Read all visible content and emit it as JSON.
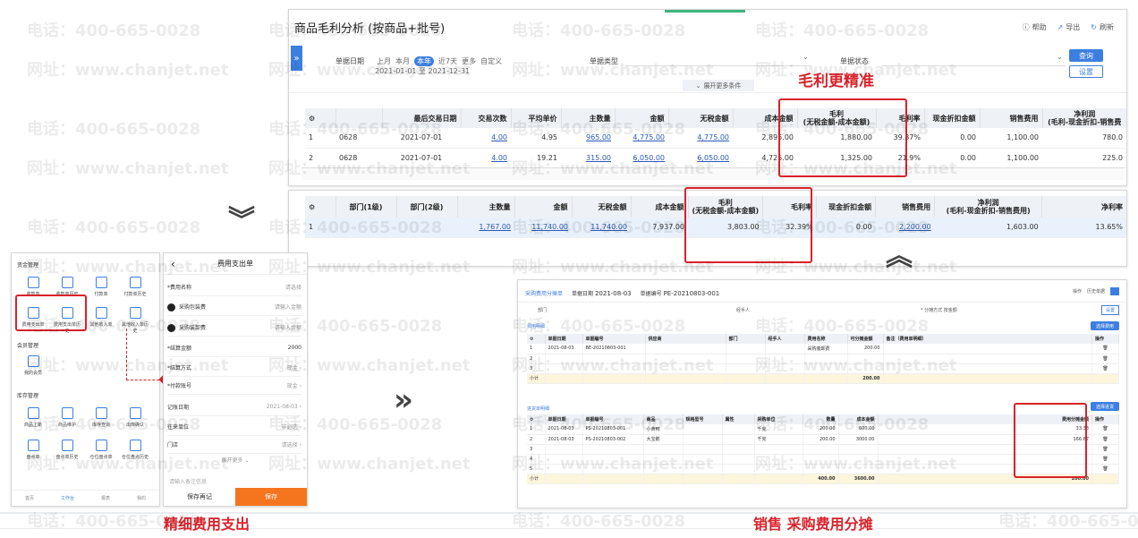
{
  "watermark": {
    "phone": "电话：400-665-0028",
    "site": "网址：www.chanjet.net"
  },
  "report": {
    "title": "商品毛利分析 (按商品+批号)",
    "help": "帮助",
    "export": "导出",
    "refresh": "刷新",
    "filter_date_label": "单据日期",
    "date_options": [
      "上月",
      "本月",
      "本年",
      "近7天",
      "更多",
      "自定义"
    ],
    "date_selected": "本年",
    "date_range_from": "2021-01-01",
    "date_range_to_word": "至",
    "date_range_to": "2021-12-31",
    "doc_type_label": "单据类型",
    "doc_status_label": "单据状态",
    "query_button": "查询",
    "settings_button": "设置",
    "expand_label": "展开更多条件",
    "table1": {
      "headers": [
        "最后交易日期",
        "交易次数",
        "平均单价",
        "主数量",
        "金额",
        "无税金额",
        "成本金额",
        "毛利",
        "毛利率",
        "现金折扣金额",
        "销售费用",
        "净利润"
      ],
      "profit_sub": "(无税金额-成本金额)",
      "net_sub": "(毛利-现金折扣-销售费",
      "rows": [
        [
          "1",
          "0628",
          "2021-07-01",
          "4.00",
          "4.95",
          "965.00",
          "4,775.00",
          "4,775.00",
          "2,895.00",
          "1,880.00",
          "39.37%",
          "0.00",
          "1,100.00",
          "780.0"
        ],
        [
          "2",
          "0628",
          "2021-07-01",
          "4.00",
          "19.21",
          "315.00",
          "6,050.00",
          "6,050.00",
          "4,725.00",
          "1,325.00",
          "21.9%",
          "0.00",
          "1,100.00",
          "225.0"
        ]
      ]
    },
    "table2": {
      "headers": [
        "部门(1级)",
        "部门(2级)",
        "主数量",
        "金额",
        "无税金额",
        "成本金额",
        "毛利",
        "毛利率",
        "现金折扣金额",
        "销售费用",
        "净利润",
        "净利率"
      ],
      "profit_sub": "(无税金额-成本金额)",
      "net_sub": "(毛利-现金折扣-销售费用)",
      "rows": [
        [
          "1",
          "",
          "",
          "1,767.00",
          "11,740.00",
          "11,740.00",
          "7,937.00",
          "3,803.00",
          "32.39%",
          "0.00",
          "2,200.00",
          "1,603.00",
          "13.65%"
        ]
      ]
    }
  },
  "captions": {
    "profit": "毛利更精准",
    "expense": "精细费用支出",
    "allocation": "销售 采购费用分摊"
  },
  "mobile_menu": {
    "section1": "资金管理",
    "items1": [
      "收款单",
      "收款单历史",
      "付款单",
      "付款单历史",
      "费用支出单",
      "费用支出单历史",
      "其他收入单",
      "其他收入单历史"
    ],
    "section2": "会员管理",
    "items2": [
      "我的会员"
    ],
    "section3": "库存管理",
    "items3": [
      "商品上新",
      "商品维护",
      "库存查询",
      "出库确认",
      "盘点单",
      "盘点单历史",
      "仓位盘点单",
      "仓位盘点历史"
    ],
    "bottom_nav": [
      "首页",
      "工作台",
      "报表",
      "我的"
    ]
  },
  "mobile_form": {
    "title": "费用支出单",
    "fields": [
      {
        "label": "*费用名称",
        "value": "请选择"
      },
      {
        "label": "采购包装费",
        "value": "请输入金额"
      },
      {
        "label": "采购装卸费",
        "value": "请输入金额"
      },
      {
        "label": "*结算金额",
        "value": "2000"
      },
      {
        "label": "*结算方式",
        "value": "现金"
      },
      {
        "label": "*付款账号",
        "value": "现金"
      },
      {
        "label": "记账日期",
        "value": "2021-08-03"
      },
      {
        "label": "往来单位",
        "value": "非必选"
      },
      {
        "label": "门店",
        "value": "请选择"
      }
    ],
    "more": "展开更多",
    "note_placeholder": "请输入备注信息",
    "save_again": "保存再记",
    "save": "保存"
  },
  "alloc": {
    "tab": "采购费用分摊单",
    "date_label": "单据日期",
    "date": "2021-08-03",
    "no_label": "单据编号",
    "no": "PE-20210803-001",
    "dept_label": "部门",
    "handler_label": "经手人",
    "method_label": "* 分摊方式",
    "method": "按金额",
    "ops": [
      "操作",
      "历史单据"
    ],
    "settings": "设置",
    "sec1": "费用明细",
    "sec1_btn": "选择费用",
    "t1_headers": [
      "",
      "单据日期",
      "单据编号",
      "供应商",
      "部门",
      "经手人",
      "费用名称",
      "可分摊金额",
      "备注（费用单明细）",
      "操作"
    ],
    "t1_rows": [
      [
        "1",
        "2021-08-03",
        "BE-20210803-001",
        "",
        "",
        "",
        "采购装卸费",
        "200.00",
        "",
        ""
      ],
      [
        "2",
        "",
        "",
        "",
        "",
        "",
        "",
        "",
        "",
        ""
      ],
      [
        "3",
        "",
        "",
        "",
        "",
        "",
        "",
        "",
        "",
        ""
      ]
    ],
    "t1_total_label": "小计",
    "t1_total": "200.00",
    "sec2": "进货单明细",
    "sec2_btn": "选择进货",
    "t2_headers": [
      "",
      "单据日期",
      "单据编号",
      "商品",
      "规格型号",
      "属性",
      "采购单位",
      "数量",
      "成本金额",
      "费用分摊金额",
      "操作"
    ],
    "t2_rows": [
      [
        "1",
        "2021-08-03",
        "PS-20210803-001",
        "小黄鸭",
        "",
        "",
        "千克",
        "200.00",
        "600.00",
        "33.33",
        ""
      ],
      [
        "2",
        "2021-08-03",
        "PS-20210803-002",
        "大宝鹅",
        "",
        "",
        "千克",
        "200.00",
        "3000.00",
        "166.67",
        ""
      ],
      [
        "3",
        "",
        "",
        "",
        "",
        "",
        "",
        "",
        "",
        "",
        ""
      ],
      [
        "4",
        "",
        "",
        "",
        "",
        "",
        "",
        "",
        "",
        "",
        ""
      ],
      [
        "5",
        "",
        "",
        "",
        "",
        "",
        "",
        "",
        "",
        "",
        ""
      ]
    ],
    "t2_total_label": "小计",
    "t2_total_qty": "400.00",
    "t2_total_cost": "3600.00",
    "t2_total_alloc": "200.00"
  }
}
